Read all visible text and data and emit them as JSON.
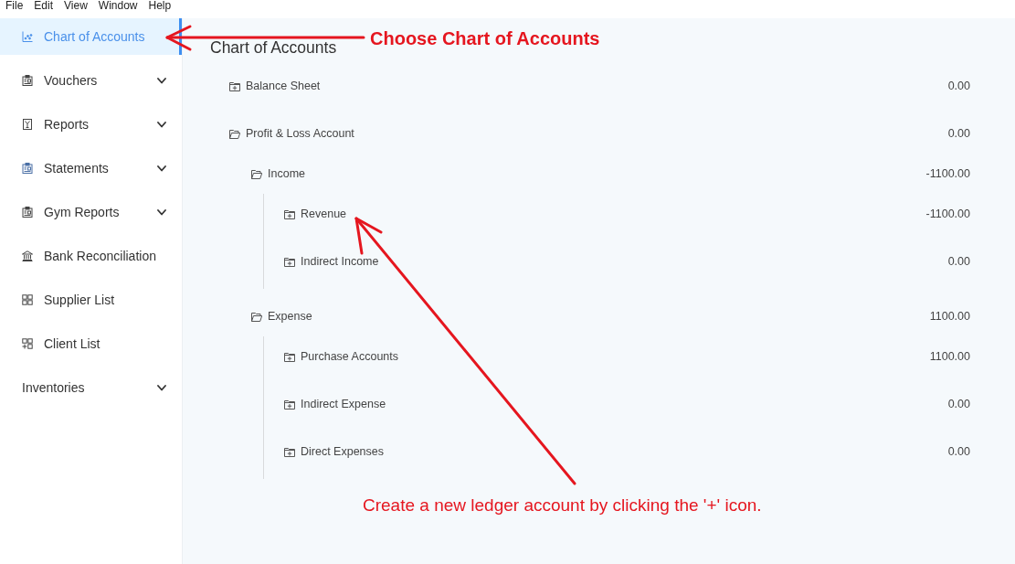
{
  "menu_bar": [
    "File",
    "Edit",
    "View",
    "Window",
    "Help"
  ],
  "sidebar": {
    "items": [
      {
        "label": "Chart of Accounts",
        "kind": "link",
        "selected": true
      },
      {
        "label": "Vouchers",
        "kind": "submenu",
        "selected": false
      },
      {
        "label": "Reports",
        "kind": "submenu",
        "selected": false
      },
      {
        "label": "Statements",
        "kind": "submenu",
        "selected": false
      },
      {
        "label": "Gym Reports",
        "kind": "submenu",
        "selected": false
      },
      {
        "label": "Bank Reconciliation",
        "kind": "link",
        "selected": false
      },
      {
        "label": "Supplier List",
        "kind": "link",
        "selected": false
      },
      {
        "label": "Client List",
        "kind": "link",
        "selected": false
      },
      {
        "label": "Inventories",
        "kind": "submenu",
        "selected": false
      }
    ]
  },
  "page_title": "Chart of Accounts",
  "accounts": [
    {
      "name": "Balance Sheet",
      "amount": "0.00",
      "expanded": false
    },
    {
      "name": "Profit & Loss Account",
      "amount": "0.00",
      "expanded": true,
      "children": [
        {
          "name": "Income",
          "amount": "-1100.00",
          "expanded": true,
          "children": [
            {
              "name": "Revenue",
              "amount": "-1100.00",
              "expanded": false
            },
            {
              "name": "Indirect Income",
              "amount": "0.00",
              "expanded": false
            }
          ]
        },
        {
          "name": "Expense",
          "amount": "1100.00",
          "expanded": true,
          "children": [
            {
              "name": "Purchase Accounts",
              "amount": "1100.00",
              "expanded": false
            },
            {
              "name": "Indirect Expense",
              "amount": "0.00",
              "expanded": false
            },
            {
              "name": "Direct Expenses",
              "amount": "0.00",
              "expanded": false
            }
          ]
        }
      ]
    }
  ],
  "annotations": [
    {
      "kind": "title",
      "text": "Choose Chart of Accounts"
    },
    {
      "kind": "note",
      "text": "Create a new ledger account by clicking the '+' icon."
    }
  ]
}
